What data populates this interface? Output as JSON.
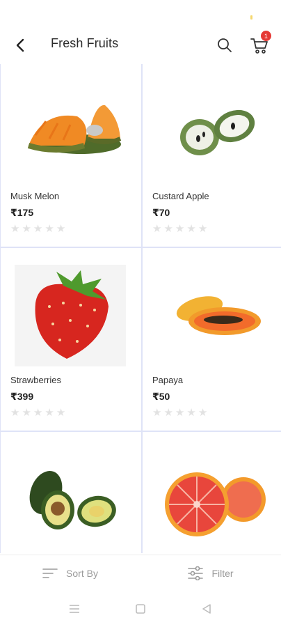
{
  "header": {
    "title": "Fresh Fruits",
    "cart_count": "1"
  },
  "products": [
    {
      "name": "Musk Melon",
      "price": "₹175",
      "rating": 0,
      "image": "musk-melon"
    },
    {
      "name": "Custard Apple",
      "price": "₹70",
      "rating": 0,
      "image": "custard-apple"
    },
    {
      "name": "Strawberries",
      "price": "₹399",
      "rating": 0,
      "image": "strawberry"
    },
    {
      "name": "Papaya",
      "price": "₹50",
      "rating": 0,
      "image": "papaya"
    },
    {
      "name": "",
      "price": "",
      "rating": 0,
      "image": "avocado"
    },
    {
      "name": "",
      "price": "",
      "rating": 0,
      "image": "grapefruit"
    }
  ],
  "bottom_bar": {
    "sort_label": "Sort By",
    "filter_label": "Filter"
  },
  "colors": {
    "accent_badge": "#e53935",
    "grid_lines": "#dfe3f7",
    "star_empty": "#e2e2e2"
  }
}
